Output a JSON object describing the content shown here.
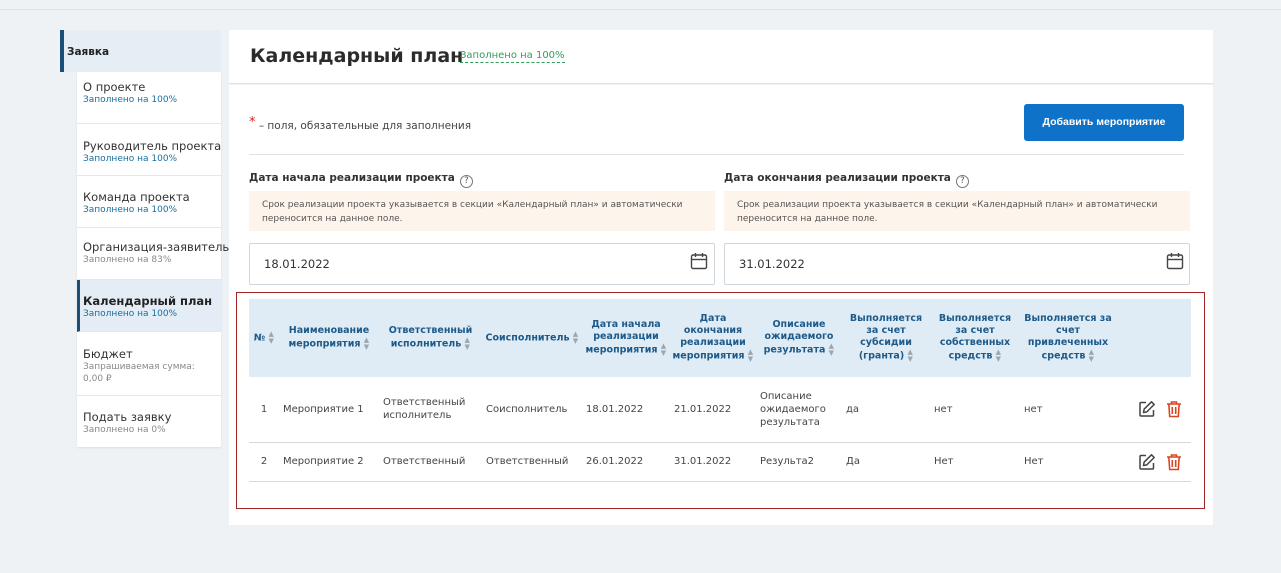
{
  "sidebar": {
    "header": "Заявка",
    "items": [
      {
        "title": "О проекте",
        "sub": "Заполнено на 100%"
      },
      {
        "title": "Руководитель проекта",
        "sub": "Заполнено на 100%"
      },
      {
        "title": "Команда проекта",
        "sub": "Заполнено на 100%"
      },
      {
        "title": "Организация-заявитель",
        "sub": "Заполнено на 83%"
      },
      {
        "title": "Календарный план",
        "sub": "Заполнено на 100%"
      },
      {
        "title": "Бюджет",
        "sub": "Запрашиваемая сумма:",
        "sub2": "0,00 ₽"
      },
      {
        "title": "Подать заявку",
        "sub": "Заполнено на 0%"
      }
    ]
  },
  "page": {
    "title": "Календарный план",
    "fill_status": "Заполнено на 100%",
    "required_note": "– поля, обязательные для заполнения",
    "add_button": "Добавить мероприятие"
  },
  "start": {
    "label": "Дата начала реализации проекта",
    "note": "Срок реализации проекта указывается в секции «Календарный план» и автоматически переносится на данное поле.",
    "value": "18.01.2022"
  },
  "end": {
    "label": "Дата окончания реализации проекта",
    "note": "Срок реализации проекта указывается в секции «Календарный план» и автоматически переносится на данное поле.",
    "value": "31.01.2022"
  },
  "table": {
    "headers": [
      "№",
      "Наименование мероприятия",
      "Ответственный исполнитель",
      "Соисполнитель",
      "Дата начала реализации мероприятия",
      "Дата окончания реализации мероприятия",
      "Описание ожидаемого результата",
      "Выполняется за счет субсидии (гранта)",
      "Выполняется за счет собственных средств",
      "Выполняется за счет привлеченных средств"
    ],
    "rows": [
      [
        "1",
        "Мероприятие 1",
        "Ответственный исполнитель",
        "Соисполнитель",
        "18.01.2022",
        "21.01.2022",
        "Описание ожидаемого результата",
        "да",
        "нет",
        "нет"
      ],
      [
        "2",
        "Мероприятие 2",
        "Ответственный",
        "Ответственный",
        "26.01.2022",
        "31.01.2022",
        "Результа2",
        "Да",
        "Нет",
        "Нет"
      ]
    ]
  },
  "colors": {
    "accent": "#0e73c8",
    "delete": "#d9451f",
    "fill_ok": "#2e9e5a"
  }
}
